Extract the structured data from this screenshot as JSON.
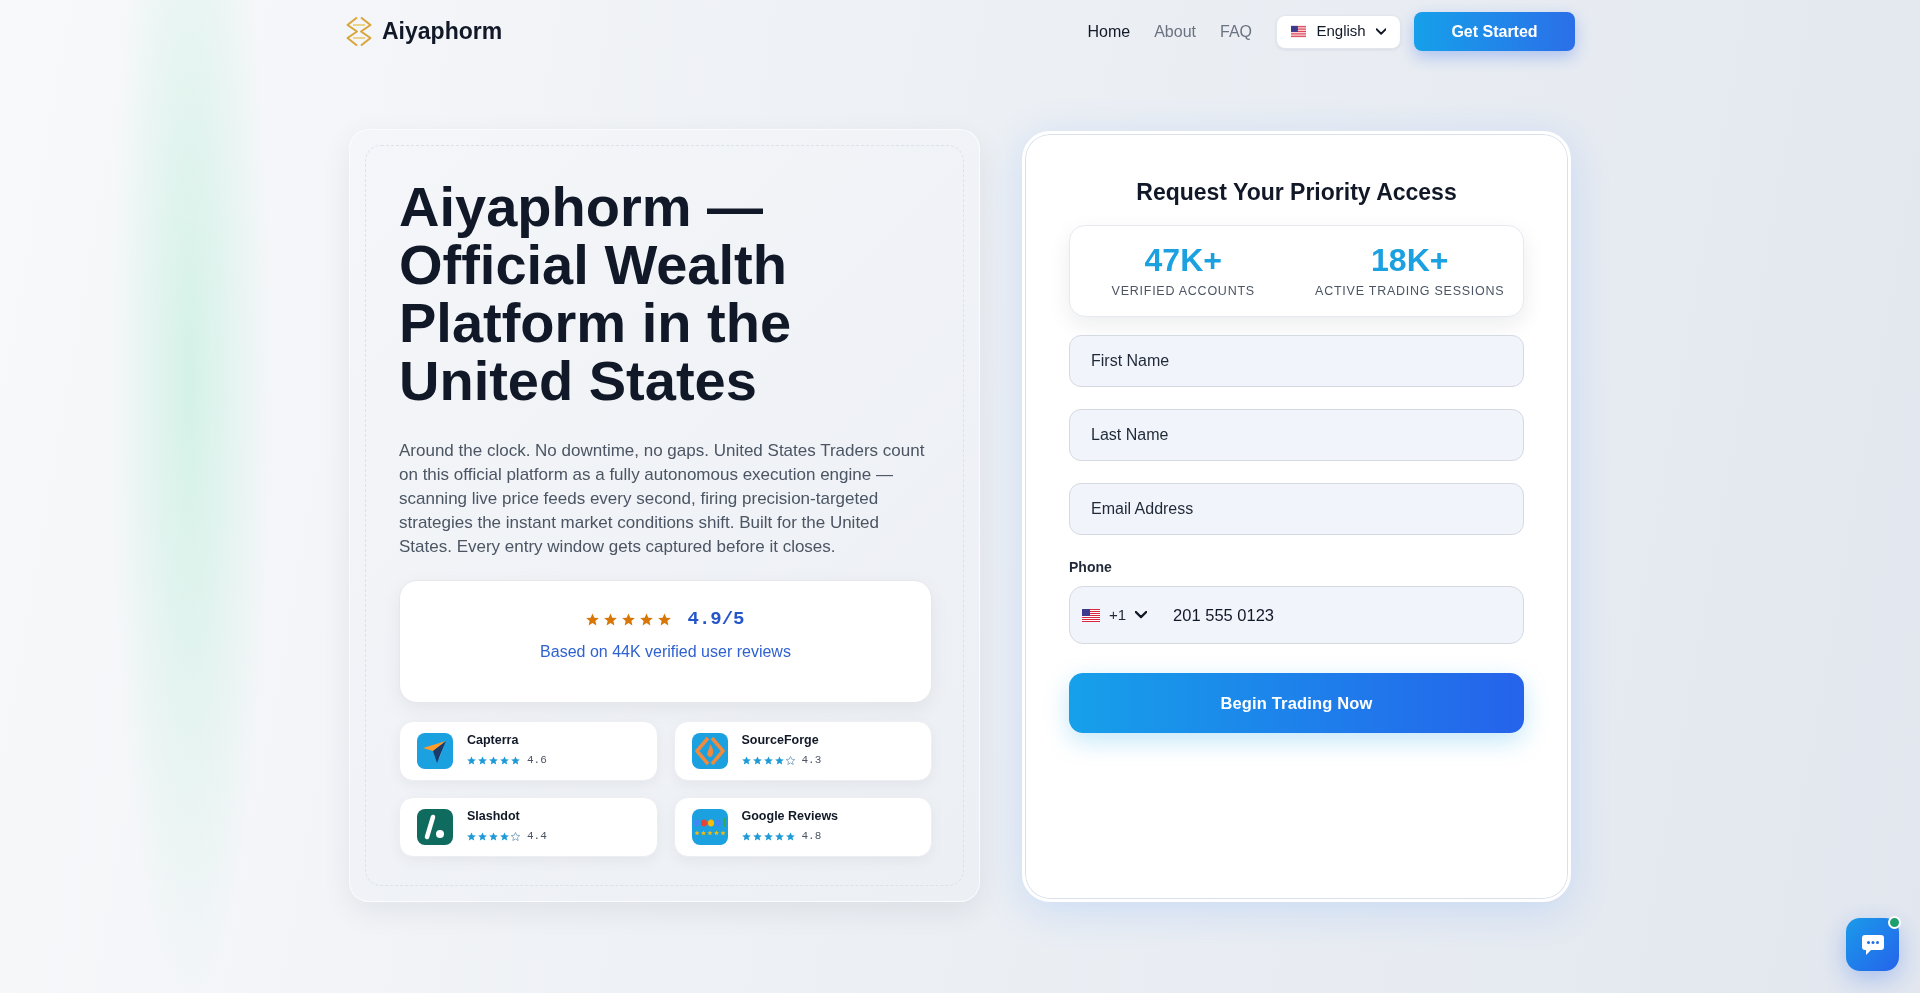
{
  "header": {
    "brand": "Aiyaphorm",
    "nav": [
      {
        "label": "Home",
        "selected": true
      },
      {
        "label": "About",
        "selected": false
      },
      {
        "label": "FAQ",
        "selected": false
      }
    ],
    "language": {
      "label": "English"
    },
    "cta": "Get Started"
  },
  "hero": {
    "title": "Aiyaphorm — Official Wealth Platform in the United States",
    "description": "Around the clock. No downtime, no gaps. United States Traders count on this official platform as a fully autonomous execution engine — scanning live price feeds every second, firing precision-targeted strategies the instant market conditions shift. Built for the United States. Every entry window gets captured before it closes.",
    "rating": {
      "stars": 5,
      "score": "4.9/5",
      "caption": "Based on 44K verified user reviews"
    },
    "reviews": [
      {
        "kind": "capterra",
        "name": "Capterra",
        "stars": 5,
        "score": "4.6"
      },
      {
        "kind": "sourceforge",
        "name": "SourceForge",
        "stars": 4,
        "score": "4.3"
      },
      {
        "kind": "slashdot",
        "name": "Slashdot",
        "stars": 4,
        "score": "4.4"
      },
      {
        "kind": "google",
        "name": "Google Reviews",
        "stars": 5,
        "score": "4.8"
      }
    ]
  },
  "form": {
    "title": "Request Your Priority Access",
    "stats": [
      {
        "value": "47K+",
        "label": "VERIFIED ACCOUNTS"
      },
      {
        "value": "18K+",
        "label": "ACTIVE TRADING SESSIONS"
      }
    ],
    "fields": [
      {
        "placeholder": "First Name"
      },
      {
        "placeholder": "Last Name"
      },
      {
        "placeholder": "Email Address"
      }
    ],
    "phone": {
      "label": "Phone",
      "country_code": "+1",
      "value": "201 555 0123"
    },
    "submit": "Begin Trading Now"
  },
  "chat": {
    "online": true
  }
}
